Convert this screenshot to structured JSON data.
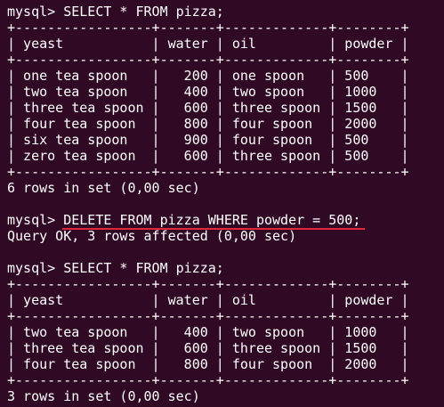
{
  "terminal": {
    "colors": {
      "background": "#300a24",
      "text": "#ffffff",
      "annotation_underline": "#e0283a"
    },
    "lines": [
      "mysql> SELECT * FROM pizza;",
      "+-----------------+-------+-------------+--------+",
      "| yeast           | water | oil         | powder |",
      "+-----------------+-------+-------------+--------+",
      "| one tea spoon   |   200 | one spoon   | 500    |",
      "| two tea spoon   |   400 | two spoon   | 1000   |",
      "| three tea spoon |   600 | three spoon | 1500   |",
      "| four tea spoon  |   800 | four spoon  | 2000   |",
      "| six tea spoon   |   900 | four spoon  | 500    |",
      "| zero tea spoon  |   600 | three spoon | 500    |",
      "+-----------------+-------+-------------+--------+",
      "6 rows in set (0,00 sec)",
      "",
      "mysql> DELETE FROM pizza WHERE powder = 500;",
      "Query OK, 3 rows affected (0,00 sec)",
      "",
      "mysql> SELECT * FROM pizza;",
      "+-----------------+-------+-------------+--------+",
      "| yeast           | water | oil         | powder |",
      "+-----------------+-------+-------------+--------+",
      "| two tea spoon   |   400 | two spoon   | 1000   |",
      "| three tea spoon |   600 | three spoon | 1500   |",
      "| four tea spoon  |   800 | four spoon  | 2000   |",
      "+-----------------+-------+-------------+--------+",
      "3 rows in set (0,00 sec)"
    ]
  }
}
